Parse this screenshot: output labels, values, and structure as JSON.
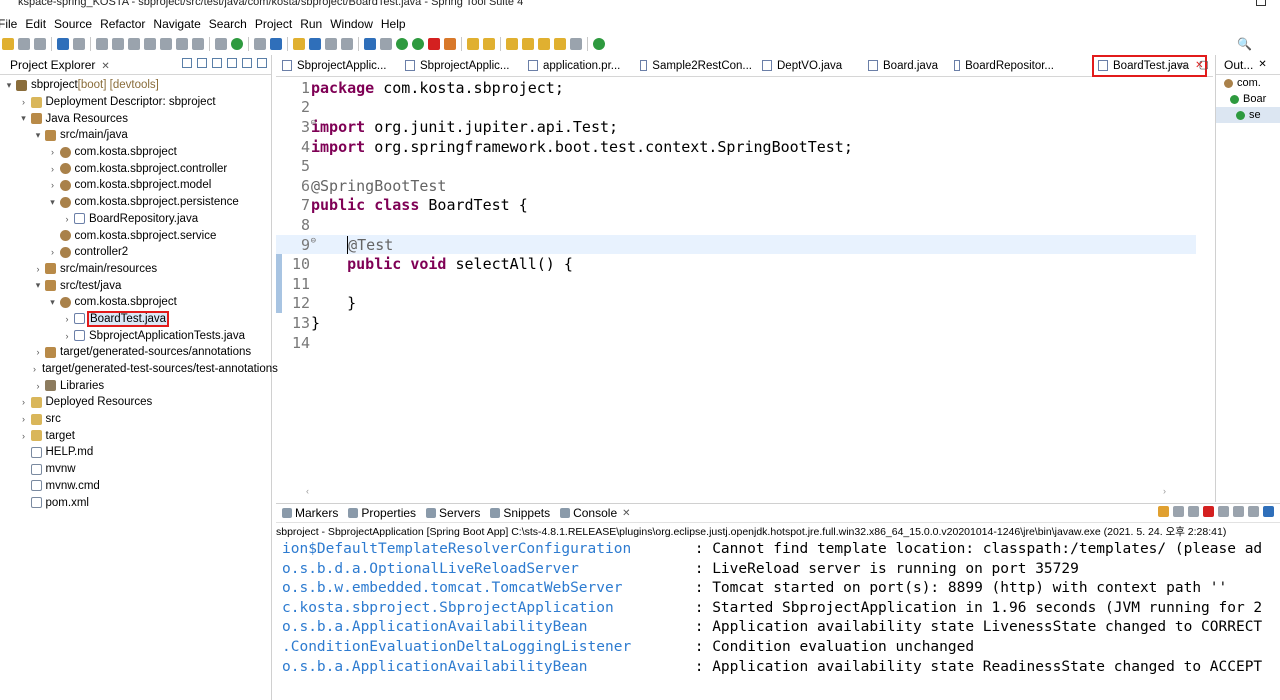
{
  "window": {
    "title": "kspace-spring_KOSTA - sbproject/src/test/java/com/kosta/sbproject/BoardTest.java - Spring Tool Suite 4"
  },
  "menu": [
    "File",
    "Edit",
    "Source",
    "Refactor",
    "Navigate",
    "Search",
    "Project",
    "Run",
    "Window",
    "Help"
  ],
  "explorer": {
    "title": "Project Explorer",
    "nodes": [
      {
        "label": "sbproject",
        "extra": " [boot] [devtools]",
        "indent": 0,
        "arrow": "▾",
        "icon": "proj"
      },
      {
        "label": "Deployment Descriptor: sbproject",
        "indent": 1,
        "arrow": "›",
        "icon": "fold"
      },
      {
        "label": "Java Resources",
        "indent": 1,
        "arrow": "▾",
        "icon": "src"
      },
      {
        "label": "src/main/java",
        "indent": 2,
        "arrow": "▾",
        "icon": "src"
      },
      {
        "label": "com.kosta.sbproject",
        "indent": 3,
        "arrow": "›",
        "icon": "pkg"
      },
      {
        "label": "com.kosta.sbproject.controller",
        "indent": 3,
        "arrow": "›",
        "icon": "pkg"
      },
      {
        "label": "com.kosta.sbproject.model",
        "indent": 3,
        "arrow": "›",
        "icon": "pkg"
      },
      {
        "label": "com.kosta.sbproject.persistence",
        "indent": 3,
        "arrow": "▾",
        "icon": "pkg"
      },
      {
        "label": "BoardRepository.java",
        "indent": 4,
        "arrow": "›",
        "icon": "java"
      },
      {
        "label": "com.kosta.sbproject.service",
        "indent": 3,
        "arrow": "",
        "icon": "pkg"
      },
      {
        "label": "controller2",
        "indent": 3,
        "arrow": "›",
        "icon": "pkg"
      },
      {
        "label": "src/main/resources",
        "indent": 2,
        "arrow": "›",
        "icon": "src"
      },
      {
        "label": "src/test/java",
        "indent": 2,
        "arrow": "▾",
        "icon": "src"
      },
      {
        "label": "com.kosta.sbproject",
        "indent": 3,
        "arrow": "▾",
        "icon": "pkg"
      },
      {
        "label": "BoardTest.java",
        "indent": 4,
        "arrow": "›",
        "icon": "java",
        "highlight": true
      },
      {
        "label": "SbprojectApplicationTests.java",
        "indent": 4,
        "arrow": "›",
        "icon": "java"
      },
      {
        "label": "target/generated-sources/annotations",
        "indent": 2,
        "arrow": "›",
        "icon": "src"
      },
      {
        "label": "target/generated-test-sources/test-annotations",
        "indent": 2,
        "arrow": "›",
        "icon": "src"
      },
      {
        "label": "Libraries",
        "indent": 2,
        "arrow": "›",
        "icon": "lib"
      },
      {
        "label": "Deployed Resources",
        "indent": 1,
        "arrow": "›",
        "icon": "fold"
      },
      {
        "label": "src",
        "indent": 1,
        "arrow": "›",
        "icon": "fold"
      },
      {
        "label": "target",
        "indent": 1,
        "arrow": "›",
        "icon": "fold"
      },
      {
        "label": "HELP.md",
        "indent": 1,
        "arrow": "",
        "icon": "file"
      },
      {
        "label": "mvnw",
        "indent": 1,
        "arrow": "",
        "icon": "file"
      },
      {
        "label": "mvnw.cmd",
        "indent": 1,
        "arrow": "",
        "icon": "file"
      },
      {
        "label": "pom.xml",
        "indent": 1,
        "arrow": "",
        "icon": "file"
      }
    ]
  },
  "editor": {
    "tabs": [
      {
        "label": "SbprojectApplic..."
      },
      {
        "label": "SbprojectApplic..."
      },
      {
        "label": "application.pr..."
      },
      {
        "label": "Sample2RestCon..."
      },
      {
        "label": "DeptVO.java"
      },
      {
        "label": "Board.java"
      },
      {
        "label": "BoardRepositor..."
      },
      {
        "label": "BoardTest.java",
        "active": true
      }
    ],
    "lines": [
      [
        {
          "t": "package",
          "c": "kw"
        },
        {
          "t": " com.kosta.sbproject;"
        }
      ],
      [],
      [
        {
          "t": "import",
          "c": "kw"
        },
        {
          "t": " org.junit.jupiter.api.Test;"
        }
      ],
      [
        {
          "t": "import",
          "c": "kw"
        },
        {
          "t": " org.springframework.boot.test.context.SpringBootTest;"
        }
      ],
      [],
      [
        {
          "t": "@SpringBootTest",
          "c": "ann"
        }
      ],
      [
        {
          "t": "public",
          "c": "kw"
        },
        {
          "t": " "
        },
        {
          "t": "class",
          "c": "kw"
        },
        {
          "t": " BoardTest {"
        }
      ],
      [],
      [
        {
          "t": "    "
        },
        {
          "t": "@Test",
          "c": "ann caret"
        }
      ],
      [
        {
          "t": "    "
        },
        {
          "t": "public",
          "c": "kw"
        },
        {
          "t": " "
        },
        {
          "t": "void",
          "c": "kw"
        },
        {
          "t": " selectAll() {"
        }
      ],
      [],
      [
        {
          "t": "    }"
        }
      ],
      [
        {
          "t": "}"
        }
      ],
      []
    ],
    "folds": {
      "3": "⊖",
      "9": "⊖"
    },
    "current_line": 9
  },
  "outline": {
    "title": "Out...",
    "rows": [
      "com.",
      "Boar",
      "se"
    ]
  },
  "console": {
    "tabs": [
      "Markers",
      "Properties",
      "Servers",
      "Snippets",
      "Console"
    ],
    "description": "sbproject - SbprojectApplication [Spring Boot App] C:\\sts-4.8.1.RELEASE\\plugins\\org.eclipse.justj.openjdk.hotspot.jre.full.win32.x86_64_15.0.0.v20201014-1246\\jre\\bin\\javaw.exe  (2021. 5. 24. 오후 2:28:41)",
    "rows": [
      {
        "logger": "ion$DefaultTemplateResolverConfiguration",
        "msg": " : Cannot find template location: classpath:/templates/ (please ad"
      },
      {
        "logger": "o.s.b.d.a.OptionalLiveReloadServer",
        "msg": " : LiveReload server is running on port 35729"
      },
      {
        "logger": "o.s.b.w.embedded.tomcat.TomcatWebServer",
        "msg": " : Tomcat started on port(s): 8899 (http) with context path ''"
      },
      {
        "logger": "c.kosta.sbproject.SbprojectApplication",
        "msg": " : Started SbprojectApplication in 1.96 seconds (JVM running for 2"
      },
      {
        "logger": "o.s.b.a.ApplicationAvailabilityBean",
        "msg": " : Application availability state LivenessState changed to CORRECT"
      },
      {
        "logger": ".ConditionEvaluationDeltaLoggingListener",
        "msg": " : Condition evaluation unchanged"
      },
      {
        "logger": "o.s.b.a.ApplicationAvailabilityBean",
        "msg": " : Application availability state ReadinessState changed to ACCEPT"
      }
    ]
  }
}
